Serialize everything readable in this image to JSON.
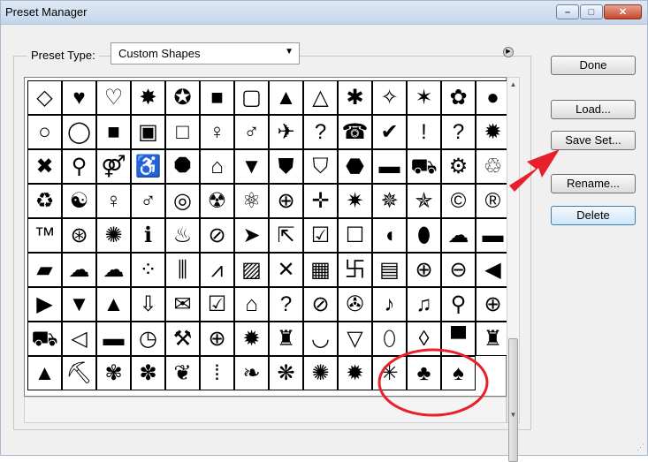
{
  "window": {
    "title": "Preset Manager"
  },
  "window_controls": {
    "minimize": "–",
    "maximize": "□",
    "close": "✕"
  },
  "preset_type": {
    "label": "Preset Type:",
    "value": "Custom Shapes",
    "arrow": "▼"
  },
  "panel_menu": {
    "glyph": "▶"
  },
  "scrollbar": {
    "up": "▲",
    "down": "▼"
  },
  "buttons": {
    "done": "Done",
    "load": "Load...",
    "save_set": "Save Set...",
    "rename": "Rename...",
    "delete": "Delete"
  },
  "annotation_colors": {
    "arrow": "#e8202a",
    "circle": "#e8202a"
  },
  "shapes": [
    [
      {
        "icon": "diamond-frame-icon",
        "g": "◇"
      },
      {
        "icon": "heart-icon",
        "g": "♥"
      },
      {
        "icon": "heart-frame-icon",
        "g": "♡"
      },
      {
        "icon": "starburst-icon",
        "g": "✸"
      },
      {
        "icon": "starburst-frame-icon",
        "g": "✪"
      },
      {
        "icon": "square-icon",
        "g": "■"
      },
      {
        "icon": "square-frame-icon",
        "g": "▢"
      },
      {
        "icon": "triangle-icon",
        "g": "▲"
      },
      {
        "icon": "triangle-frame-icon",
        "g": "△"
      },
      {
        "icon": "blob-icon",
        "g": "✱"
      },
      {
        "icon": "puzzle-frame-icon",
        "g": "✧"
      },
      {
        "icon": "asterisk-icon",
        "g": "✶"
      },
      {
        "icon": "flower-frame-icon",
        "g": "✿"
      },
      {
        "icon": "circle-icon",
        "g": "●"
      }
    ],
    [
      {
        "icon": "ring-icon",
        "g": "○"
      },
      {
        "icon": "circle-frame-icon",
        "g": "◯"
      },
      {
        "icon": "square-icon",
        "g": "■"
      },
      {
        "icon": "square-frame-thick-icon",
        "g": "▣"
      },
      {
        "icon": "square-frame-thin-icon",
        "g": "□"
      },
      {
        "icon": "woman-icon",
        "g": "♀"
      },
      {
        "icon": "man-icon",
        "g": "♂"
      },
      {
        "icon": "airplane-icon",
        "g": "✈"
      },
      {
        "icon": "help-icon",
        "g": "?"
      },
      {
        "icon": "phone-icon",
        "g": "☎"
      },
      {
        "icon": "checkmark-icon",
        "g": "✔"
      },
      {
        "icon": "exclamation-icon",
        "g": "!"
      },
      {
        "icon": "question-icon",
        "g": "?"
      },
      {
        "icon": "burst-icon",
        "g": "✹"
      }
    ],
    [
      {
        "icon": "x-icon",
        "g": "✖"
      },
      {
        "icon": "walking-icon",
        "g": "⚲"
      },
      {
        "icon": "couple-icon",
        "g": "⚤"
      },
      {
        "icon": "wheelchair-icon",
        "g": "♿"
      },
      {
        "icon": "octagon-icon",
        "g": "⯃"
      },
      {
        "icon": "house-icon",
        "g": "⌂"
      },
      {
        "icon": "down-triangle-icon",
        "g": "▼"
      },
      {
        "icon": "shield-sign-icon",
        "g": "⛊"
      },
      {
        "icon": "shield-icon",
        "g": "⛉"
      },
      {
        "icon": "badge-icon",
        "g": "⬣"
      },
      {
        "icon": "car-side-icon",
        "g": "▬"
      },
      {
        "icon": "car-front-icon",
        "g": "⛟"
      },
      {
        "icon": "bicycle-icon",
        "g": "⚙"
      },
      {
        "icon": "recycle-frame-icon",
        "g": "♲"
      }
    ],
    [
      {
        "icon": "recycle-icon",
        "g": "♻"
      },
      {
        "icon": "yin-yang-icon",
        "g": "☯"
      },
      {
        "icon": "female-icon",
        "g": "♀"
      },
      {
        "icon": "male-icon",
        "g": "♂"
      },
      {
        "icon": "target-icon",
        "g": "◎"
      },
      {
        "icon": "radioactive-icon",
        "g": "☢"
      },
      {
        "icon": "atom-icon",
        "g": "⚛"
      },
      {
        "icon": "globe-icon",
        "g": "⊕"
      },
      {
        "icon": "crosshair-icon",
        "g": "✛"
      },
      {
        "icon": "sparkle-icon",
        "g": "✷"
      },
      {
        "icon": "sparkle-frame-icon",
        "g": "✵"
      },
      {
        "icon": "star-frame-icon",
        "g": "✯"
      },
      {
        "icon": "copyright-icon",
        "g": "©"
      },
      {
        "icon": "registered-icon",
        "g": "®"
      }
    ],
    [
      {
        "icon": "trademark-icon",
        "g": "™"
      },
      {
        "icon": "registration-target-icon",
        "g": "⊛"
      },
      {
        "icon": "radial-icon",
        "g": "✺"
      },
      {
        "icon": "info-icon",
        "g": "ℹ"
      },
      {
        "icon": "fire-icon",
        "g": "♨"
      },
      {
        "icon": "no-icon",
        "g": "⊘"
      },
      {
        "icon": "cursor-icon",
        "g": "➤"
      },
      {
        "icon": "cursor-frame-icon",
        "g": "⇱"
      },
      {
        "icon": "checkbox-icon",
        "g": "☑"
      },
      {
        "icon": "blank-icon",
        "g": "☐"
      },
      {
        "icon": "speech-bubble-icon",
        "g": "◖"
      },
      {
        "icon": "speech-oval-icon",
        "g": "⬮"
      },
      {
        "icon": "cloud-bubble-icon",
        "g": "☁"
      },
      {
        "icon": "talk-square-icon",
        "g": "▬"
      }
    ],
    [
      {
        "icon": "talk-icon",
        "g": "▰"
      },
      {
        "icon": "thought-icon",
        "g": "☁"
      },
      {
        "icon": "thought-cloud-icon",
        "g": "☁"
      },
      {
        "icon": "dots-icon",
        "g": "⁘"
      },
      {
        "icon": "grass-icon",
        "g": "⫼"
      },
      {
        "icon": "zigzag-icon",
        "g": "⩘"
      },
      {
        "icon": "diagonal-lines-icon",
        "g": "▨"
      },
      {
        "icon": "cross-lines-icon",
        "g": "✕"
      },
      {
        "icon": "checker-icon",
        "g": "▦"
      },
      {
        "icon": "greek-key-icon",
        "g": "卐"
      },
      {
        "icon": "grid-icon",
        "g": "▤"
      },
      {
        "icon": "plus-circle-icon",
        "g": "⊕"
      },
      {
        "icon": "minus-circle-icon",
        "g": "⊖"
      },
      {
        "icon": "left-arrow-circle-icon",
        "g": "◀"
      }
    ],
    [
      {
        "icon": "right-arrow-circle-icon",
        "g": "▶"
      },
      {
        "icon": "down-arrow-circle-icon",
        "g": "▼"
      },
      {
        "icon": "up-arrow-circle-icon",
        "g": "▲"
      },
      {
        "icon": "save-icon",
        "g": "⇩"
      },
      {
        "icon": "envelope-icon",
        "g": "✉"
      },
      {
        "icon": "checkbox-checked-icon",
        "g": "☑"
      },
      {
        "icon": "home-icon",
        "g": "⌂"
      },
      {
        "icon": "question-circle-icon",
        "g": "?"
      },
      {
        "icon": "prohibited-icon",
        "g": "⊘"
      },
      {
        "icon": "film-icon",
        "g": "✇"
      },
      {
        "icon": "music-note-icon",
        "g": "♪"
      },
      {
        "icon": "music-notes-icon",
        "g": "♫"
      },
      {
        "icon": "search-icon",
        "g": "⚲"
      },
      {
        "icon": "web-search-icon",
        "g": "⊕"
      }
    ],
    [
      {
        "icon": "cart-icon",
        "g": "⛟"
      },
      {
        "icon": "speaker-icon",
        "g": "◁"
      },
      {
        "icon": "minus-bar-icon",
        "g": "▬"
      },
      {
        "icon": "clock-icon",
        "g": "◷"
      },
      {
        "icon": "tools-icon",
        "g": "⚒"
      },
      {
        "icon": "globe-frame-icon",
        "g": "⊕"
      },
      {
        "icon": "splat-icon",
        "g": "✹"
      },
      {
        "icon": "bodysuit-icon",
        "g": "♜"
      },
      {
        "icon": "bra-icon",
        "g": "◡"
      },
      {
        "icon": "panties-icon",
        "g": "▽"
      },
      {
        "icon": "footprint-icon",
        "g": "⬯"
      },
      {
        "icon": "flame-frame-icon",
        "g": "◊"
      },
      {
        "icon": "banner-icon",
        "g": "▀"
      },
      {
        "icon": "castle-icon",
        "g": "♜"
      }
    ],
    [
      {
        "icon": "cone-icon",
        "g": "▲"
      },
      {
        "icon": "shovel-icon",
        "g": "⛏"
      },
      {
        "icon": "flower-outline-icon",
        "g": "✾"
      },
      {
        "icon": "flower-frame2-icon",
        "g": "✽"
      },
      {
        "icon": "ornament-icon",
        "g": "❦"
      },
      {
        "icon": "dotted-ornament-icon",
        "g": "⁞"
      },
      {
        "icon": "swirl-icon",
        "g": "❧"
      },
      {
        "icon": "butterfly-icon",
        "g": "❋"
      },
      {
        "icon": "wavy-circle-icon",
        "g": "✺"
      },
      {
        "icon": "seal-icon",
        "g": "✹"
      },
      {
        "icon": "burst-lines-icon",
        "g": "✳"
      },
      {
        "icon": "tree-icon",
        "g": "♣"
      },
      {
        "icon": "tree2-icon",
        "g": "♠"
      }
    ]
  ]
}
